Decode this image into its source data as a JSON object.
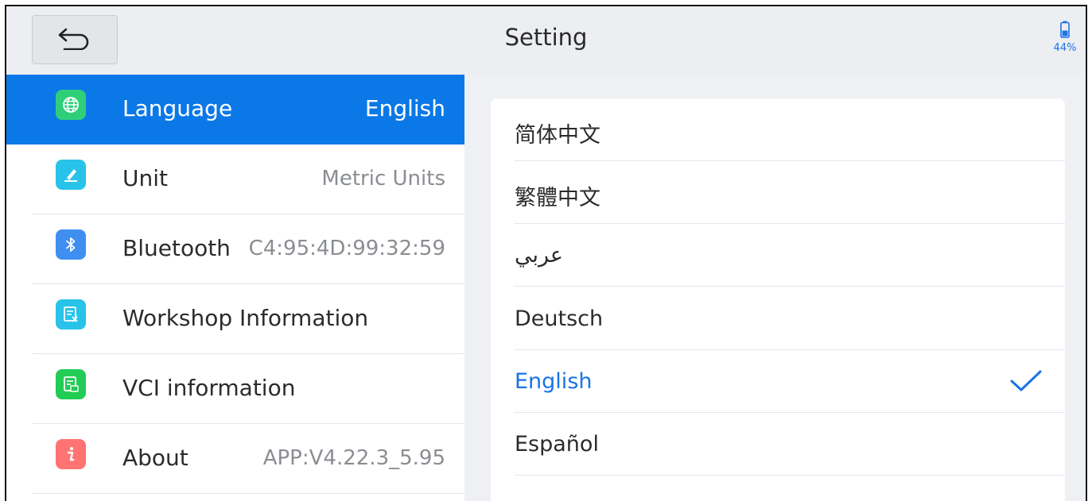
{
  "header": {
    "title": "Setting",
    "battery_percent": "44%"
  },
  "menu": {
    "items": [
      {
        "label": "Language",
        "value": "English",
        "icon": "globe-icon",
        "icon_color": "#2fcf7a",
        "active": true
      },
      {
        "label": "Unit",
        "value": "Metric Units",
        "icon": "ruler-pencil-icon",
        "icon_color": "#29c3ea"
      },
      {
        "label": "Bluetooth",
        "value": "C4:95:4D:99:32:59",
        "icon": "bluetooth-icon",
        "icon_color": "#3f8ff0"
      },
      {
        "label": "Workshop Information",
        "value": "",
        "icon": "workshop-doc-icon",
        "icon_color": "#29c3ea"
      },
      {
        "label": "VCI information",
        "value": "",
        "icon": "vci-doc-icon",
        "icon_color": "#22cc55"
      },
      {
        "label": "About",
        "value": "APP:V4.22.3_5.95",
        "icon": "info-icon",
        "icon_color": "#ff7373"
      }
    ]
  },
  "languages": {
    "items": [
      "简体中文",
      "繁體中文",
      "عربي",
      "Deutsch",
      "English",
      "Español"
    ],
    "selected": "English"
  },
  "colors": {
    "accent": "#0b78e8",
    "selected_text": "#1a73e8"
  }
}
